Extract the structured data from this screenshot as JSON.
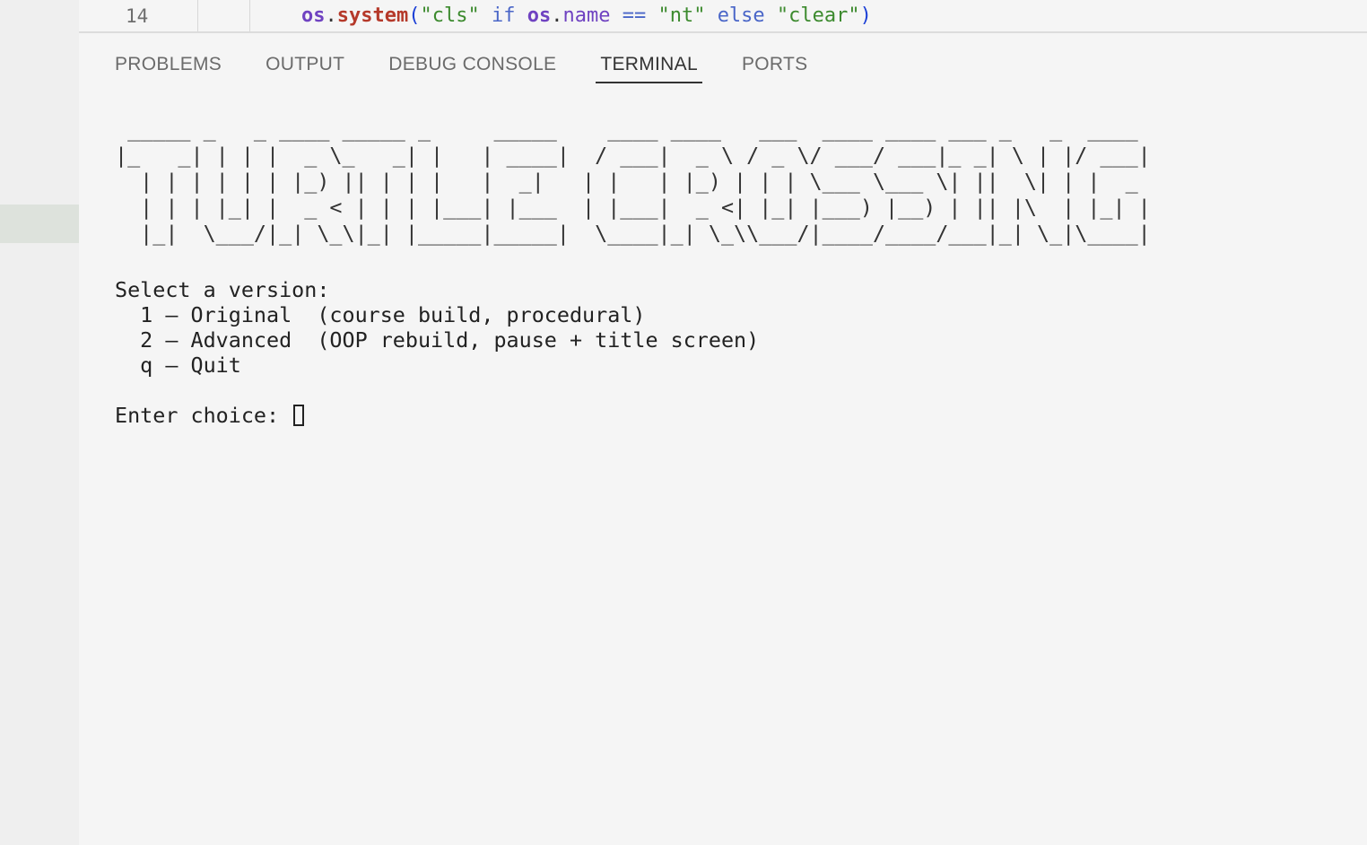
{
  "editor": {
    "line_number": "14",
    "code_tokens": [
      {
        "cls": "tk-mod",
        "text": "os"
      },
      {
        "cls": "tk-dot",
        "text": "."
      },
      {
        "cls": "tk-fn",
        "text": "system"
      },
      {
        "cls": "tk-paren",
        "text": "("
      },
      {
        "cls": "tk-str",
        "text": "\"cls\""
      },
      {
        "cls": "tk-dot",
        "text": " "
      },
      {
        "cls": "tk-kw",
        "text": "if"
      },
      {
        "cls": "tk-dot",
        "text": " "
      },
      {
        "cls": "tk-mod",
        "text": "os"
      },
      {
        "cls": "tk-dot",
        "text": "."
      },
      {
        "cls": "tk-attr",
        "text": "name"
      },
      {
        "cls": "tk-dot",
        "text": " "
      },
      {
        "cls": "tk-op",
        "text": "=="
      },
      {
        "cls": "tk-dot",
        "text": " "
      },
      {
        "cls": "tk-str",
        "text": "\"nt\""
      },
      {
        "cls": "tk-dot",
        "text": " "
      },
      {
        "cls": "tk-kw",
        "text": "else"
      },
      {
        "cls": "tk-dot",
        "text": " "
      },
      {
        "cls": "tk-str",
        "text": "\"clear\""
      },
      {
        "cls": "tk-paren",
        "text": ")"
      }
    ]
  },
  "panel": {
    "tabs": [
      {
        "label": "PROBLEMS",
        "active": false
      },
      {
        "label": "OUTPUT",
        "active": false
      },
      {
        "label": "DEBUG CONSOLE",
        "active": false
      },
      {
        "label": "TERMINAL",
        "active": true
      },
      {
        "label": "PORTS",
        "active": false
      }
    ]
  },
  "terminal": {
    "banner": " _____ _   _ ____ _____ _     _____    ____ ____   ___  ____ ____ ___ _   _  ____ \n|_   _| | | |  _ \\_   _| |   | ____|  / ___|  _ \\ / _ \\/ ___/ ___|_ _| \\ | |/ ___|\n  | | | | | | |_) || | | |   |  _|   | |   | |_) | | | \\___ \\___ \\| ||  \\| | |  _ \n  | | | |_| |  _ < | | | |___| |___  | |___|  _ <| |_| |___) |__) | || |\\  | |_| |\n  |_|  \\___/|_| \\_\\|_| |_____|_____|  \\____|_| \\_\\\\___/|____/____/___|_| \\_|\\____|",
    "menu_title": "Select a version:",
    "options": [
      "  1 — Original  (course build, procedural)",
      "  2 — Advanced  (OOP rebuild, pause + title screen)",
      "  q — Quit"
    ],
    "prompt": "Enter choice: "
  }
}
